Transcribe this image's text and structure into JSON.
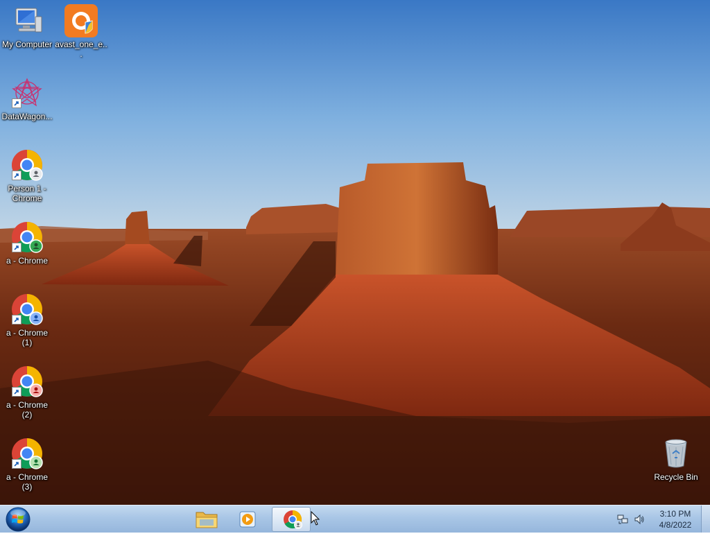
{
  "desktop": {
    "wallpaper": "monument-valley-desert",
    "icons": [
      {
        "label": "My Computer",
        "icon": "computer-icon"
      },
      {
        "label": "avast_one_e...",
        "icon": "avast-icon"
      },
      {
        "label": "DataWagon...",
        "icon": "datawagon-icon"
      },
      {
        "label": "Person 1 - Chrome",
        "icon": "chrome-profile-icon"
      },
      {
        "label": "a - Chrome",
        "icon": "chrome-profile-icon"
      },
      {
        "label": "a - Chrome (1)",
        "icon": "chrome-profile-icon"
      },
      {
        "label": "a - Chrome (2)",
        "icon": "chrome-profile-icon"
      },
      {
        "label": "a - Chrome (3)",
        "icon": "chrome-profile-icon"
      },
      {
        "label": "Recycle Bin",
        "icon": "recycle-bin-icon"
      }
    ]
  },
  "taskbar": {
    "start": "windows-start-orb",
    "pinned": [
      {
        "name": "Windows Explorer",
        "icon": "folder-icon"
      },
      {
        "name": "Windows Media Player",
        "icon": "media-player-icon"
      },
      {
        "name": "Google Chrome",
        "icon": "chrome-icon",
        "active": true
      }
    ],
    "tray": [
      "network-icon",
      "volume-icon"
    ],
    "clock": {
      "time": "3:10 PM",
      "date": "4/8/2022"
    }
  },
  "colors": {
    "taskbar": "#a9c6e6",
    "chrome_red": "#db4437",
    "chrome_green": "#0f9d58",
    "chrome_yellow": "#f4b400",
    "chrome_blue": "#4285f4",
    "avast_orange": "#f27b21"
  }
}
